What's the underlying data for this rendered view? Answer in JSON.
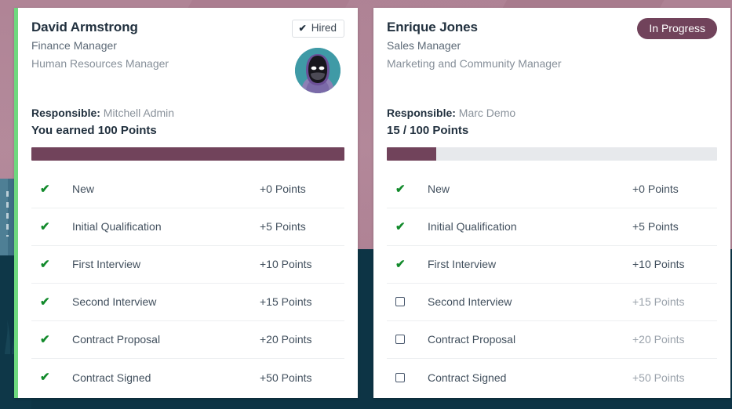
{
  "theme": {
    "accent_mauve": "#71435b",
    "stripe_green": "#6fd87f",
    "check_green": "#128a2b",
    "title_navy": "#22313f",
    "background_rose": "#ad7f92",
    "background_teal": "#0d3445",
    "progress_track": "#e7e9ec"
  },
  "cards": [
    {
      "id": "david-armstrong",
      "has_accent_stripe": true,
      "person_name": "David Armstrong",
      "job_position": "Finance Manager",
      "department": "Human Resources Manager",
      "badge": {
        "type": "hired",
        "label": "Hired",
        "icon": "check-icon",
        "check_glyph": "✔"
      },
      "avatar": {
        "icon": "user-avatar",
        "alt": "Employee avatar illustration"
      },
      "responsible_label": "Responsible:",
      "responsible_value": "Mitchell Admin",
      "points_line": "You earned 100 Points",
      "progress": {
        "percent": 100,
        "earned": 100,
        "total": 100
      },
      "stages": [
        {
          "name": "New",
          "points": "+0 Points",
          "done": true
        },
        {
          "name": "Initial Qualification",
          "points": "+5 Points",
          "done": true
        },
        {
          "name": "First Interview",
          "points": "+10 Points",
          "done": true
        },
        {
          "name": "Second Interview",
          "points": "+15 Points",
          "done": true
        },
        {
          "name": "Contract Proposal",
          "points": "+20 Points",
          "done": true
        },
        {
          "name": "Contract Signed",
          "points": "+50 Points",
          "done": true
        }
      ]
    },
    {
      "id": "enrique-jones",
      "has_accent_stripe": false,
      "person_name": "Enrique Jones",
      "job_position": "Sales Manager",
      "department": "Marketing and Community Manager",
      "badge": {
        "type": "in-progress",
        "label": "In Progress"
      },
      "responsible_label": "Responsible:",
      "responsible_value": "Marc Demo",
      "points_line": "15 / 100 Points",
      "progress": {
        "percent": 15,
        "earned": 15,
        "total": 100
      },
      "stages": [
        {
          "name": "New",
          "points": "+0 Points",
          "done": true
        },
        {
          "name": "Initial Qualification",
          "points": "+5 Points",
          "done": true
        },
        {
          "name": "First Interview",
          "points": "+10 Points",
          "done": true
        },
        {
          "name": "Second Interview",
          "points": "+15 Points",
          "done": false
        },
        {
          "name": "Contract Proposal",
          "points": "+20 Points",
          "done": false
        },
        {
          "name": "Contract Signed",
          "points": "+50 Points",
          "done": false
        }
      ]
    }
  ]
}
